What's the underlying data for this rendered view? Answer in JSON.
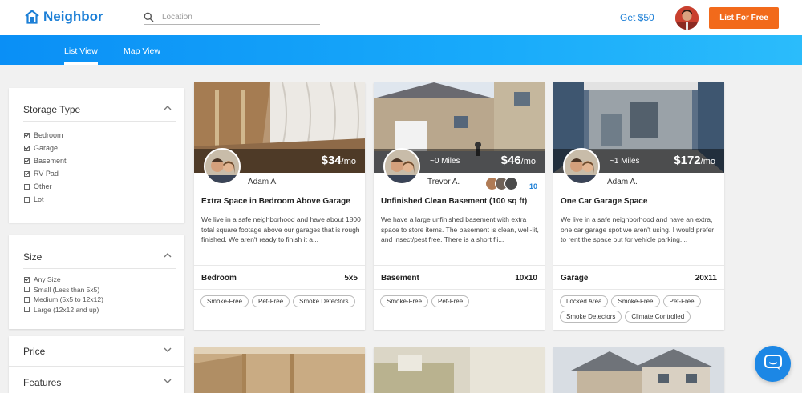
{
  "header": {
    "brand": "Neighbor",
    "search_placeholder": "Location",
    "get_50": "Get $50",
    "list_free": "List For Free"
  },
  "subnav": {
    "tabs": [
      "List View",
      "Map View"
    ],
    "active": "List View"
  },
  "filters": {
    "storage_type": {
      "title": "Storage Type",
      "options": [
        {
          "label": "Bedroom",
          "checked": true
        },
        {
          "label": "Garage",
          "checked": true
        },
        {
          "label": "Basement",
          "checked": true
        },
        {
          "label": "RV Pad",
          "checked": true
        },
        {
          "label": "Other",
          "checked": false
        },
        {
          "label": "Lot",
          "checked": false
        }
      ]
    },
    "size": {
      "title": "Size",
      "options": [
        {
          "label": "Any Size",
          "checked": true
        },
        {
          "label": "Small (Less than 5x5)",
          "checked": false
        },
        {
          "label": "Medium (5x5 to 12x12)",
          "checked": false
        },
        {
          "label": "Large (12x12 and up)",
          "checked": false
        }
      ]
    },
    "price": {
      "title": "Price"
    },
    "features": {
      "title": "Features"
    }
  },
  "listings": [
    {
      "price": "$34",
      "unit": "/mo",
      "host": "Adam A.",
      "title": "Extra Space in Bedroom Above Garage",
      "description": "We live in a safe neighborhood and have about 1800 total square footage above our garages that is rough finished. We aren't ready to finish it a...",
      "type": "Bedroom",
      "size": "5x5",
      "tags": [
        "Smoke-Free",
        "Pet-Free",
        "Smoke Detectors"
      ]
    },
    {
      "price": "$46",
      "unit": "/mo",
      "distance": "~0 Miles",
      "host": "Trevor A.",
      "favorites": "10",
      "title": "Unfinished Clean Basement (100 sq ft)",
      "description": "We have a large unfinished basement with extra space to store items. The basement is clean, well-lit, and insect/pest free. There is a short fli...",
      "type": "Basement",
      "size": "10x10",
      "tags": [
        "Smoke-Free",
        "Pet-Free"
      ]
    },
    {
      "price": "$172",
      "unit": "/mo",
      "distance": "~1 Miles",
      "host": "Adam A.",
      "title": "One Car Garage Space",
      "description": "We live in a safe neighborhood and have an extra, one car garage spot we aren't using. I would prefer to rent the space out for vehicle parking....",
      "type": "Garage",
      "size": "20x11",
      "tags": [
        "Locked Area",
        "Smoke-Free",
        "Pet-Free",
        "Smoke Detectors",
        "Climate Controlled"
      ]
    }
  ],
  "colors": {
    "brand": "#1c7fd6",
    "cta": "#f26a1b"
  }
}
